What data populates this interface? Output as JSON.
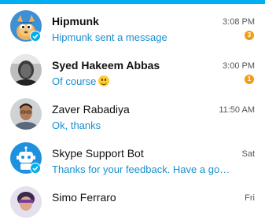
{
  "colors": {
    "accent": "#00aff0",
    "link_text": "#1a8fcf",
    "badge": "#f39c12"
  },
  "conversations": [
    {
      "name": "Hipmunk",
      "message": "Hipmunk sent a message",
      "time": "3:08 PM",
      "unread": "3",
      "avatar_icon": "hipmunk-logo-icon"
    },
    {
      "name": "Syed Hakeem Abbas",
      "message": "Of course",
      "time": "3:00 PM",
      "unread": "1",
      "avatar_icon": "profile-photo-icon"
    },
    {
      "name": "Zaver Rabadiya",
      "message": "Ok, thanks",
      "time": "11:50 AM",
      "avatar_icon": "profile-photo-icon"
    },
    {
      "name": "Skype Support Bot",
      "message": "Thanks for your feedback. Have a good day...",
      "time": "Sat",
      "avatar_icon": "robot-icon"
    },
    {
      "name": "Simo Ferraro",
      "time": "Fri",
      "avatar_icon": "profile-photo-icon"
    }
  ]
}
